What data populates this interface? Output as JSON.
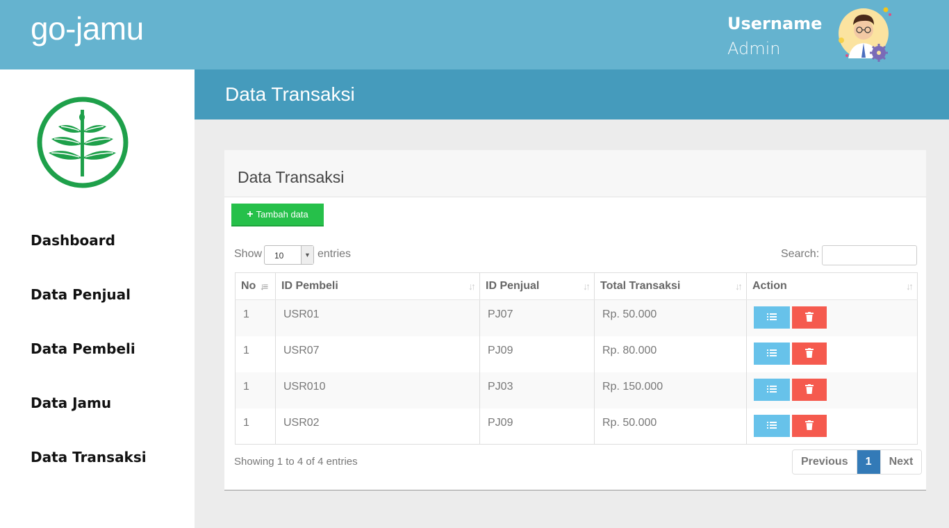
{
  "app": {
    "brand": "go-jamu"
  },
  "user": {
    "name": "Username",
    "role": "Admin"
  },
  "sidebar": {
    "items": [
      {
        "label": "Dashboard"
      },
      {
        "label": "Data Penjual"
      },
      {
        "label": "Data Pembeli"
      },
      {
        "label": "Data Jamu"
      },
      {
        "label": "Data Transaksi"
      }
    ]
  },
  "header": {
    "title": "Data Transaksi"
  },
  "panel": {
    "title": "Data Transaksi",
    "add_label": "Tambah data",
    "show_label": "Show",
    "entries_value": "10",
    "entries_label": "entries",
    "search_label": "Search:",
    "search_value": "",
    "columns": [
      "No",
      "ID Pembeli",
      "ID Penjual",
      "Total Transaksi",
      "Action"
    ],
    "rows": [
      {
        "no": "1",
        "pembeli": "USR01",
        "penjual": "PJ07",
        "total": "Rp. 50.000"
      },
      {
        "no": "1",
        "pembeli": "USR07",
        "penjual": "PJ09",
        "total": "Rp. 80.000"
      },
      {
        "no": "1",
        "pembeli": "USR010",
        "penjual": "PJ03",
        "total": "Rp. 150.000"
      },
      {
        "no": "1",
        "pembeli": "USR02",
        "penjual": "PJ09",
        "total": "Rp. 50.000"
      }
    ],
    "info": "Showing 1 to 4 of 4 entries",
    "pagination": {
      "previous": "Previous",
      "current": "1",
      "next": "Next"
    }
  },
  "colors": {
    "topbar": "#65b3cf",
    "page_header": "#459bbc",
    "add_button": "#26c04a",
    "detail_button": "#67c2ea",
    "delete_button": "#f55a4e",
    "active_page": "#337ab7",
    "logo": "#1ea04a"
  },
  "icons": {
    "add": "plus-icon",
    "detail": "list-icon",
    "delete": "trash-icon",
    "sort": "sort-icon",
    "avatar": "user-avatar-with-gear",
    "logo": "leaf-plant-logo"
  }
}
